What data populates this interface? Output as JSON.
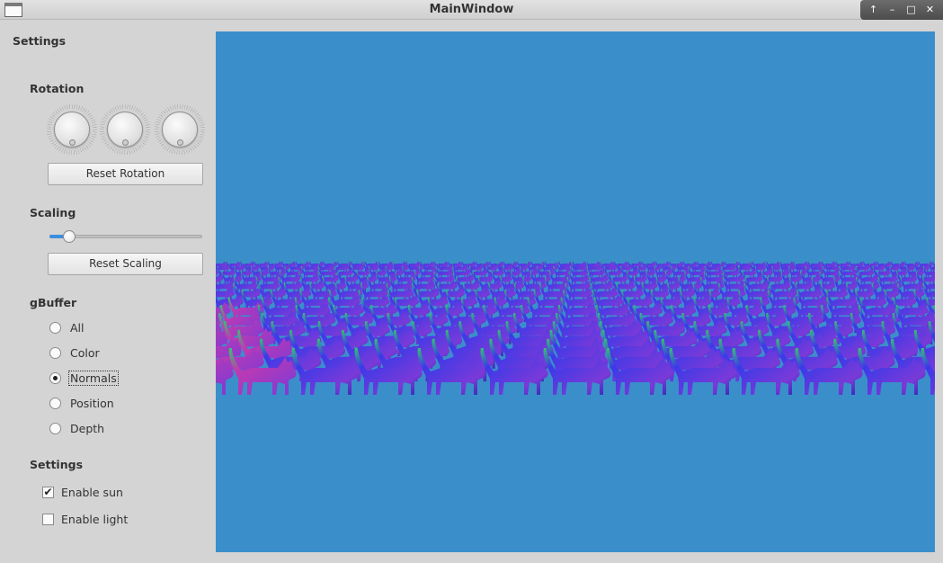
{
  "window": {
    "title": "MainWindow",
    "controls": {
      "up": "↑",
      "minimize": "–",
      "maximize": "□",
      "close": "✕"
    }
  },
  "sidebar": {
    "title": "Settings",
    "rotation": {
      "label": "Rotation",
      "dials": [
        {
          "name": "x"
        },
        {
          "name": "y"
        },
        {
          "name": "z"
        }
      ],
      "reset_label": "Reset Rotation"
    },
    "scaling": {
      "label": "Scaling",
      "slider_fraction": 0.09,
      "reset_label": "Reset Scaling"
    },
    "gbuffer": {
      "label": "gBuffer",
      "options": [
        {
          "label": "All",
          "checked": false
        },
        {
          "label": "Color",
          "checked": false
        },
        {
          "label": "Normals",
          "checked": true
        },
        {
          "label": "Position",
          "checked": false
        },
        {
          "label": "Depth",
          "checked": false
        }
      ]
    },
    "settings": {
      "label": "Settings",
      "enable_sun": {
        "label": "Enable sun",
        "checked": true
      },
      "enable_light": {
        "label": "Enable light",
        "checked": false
      }
    }
  },
  "viewport": {
    "background": "#3a8fcb",
    "content": "grid of cat models rendered with normals gBuffer",
    "colors": {
      "blue": "#3a3ae8",
      "violet": "#7a3ad8",
      "green": "#36c470",
      "magenta": "#c03ab0"
    }
  }
}
